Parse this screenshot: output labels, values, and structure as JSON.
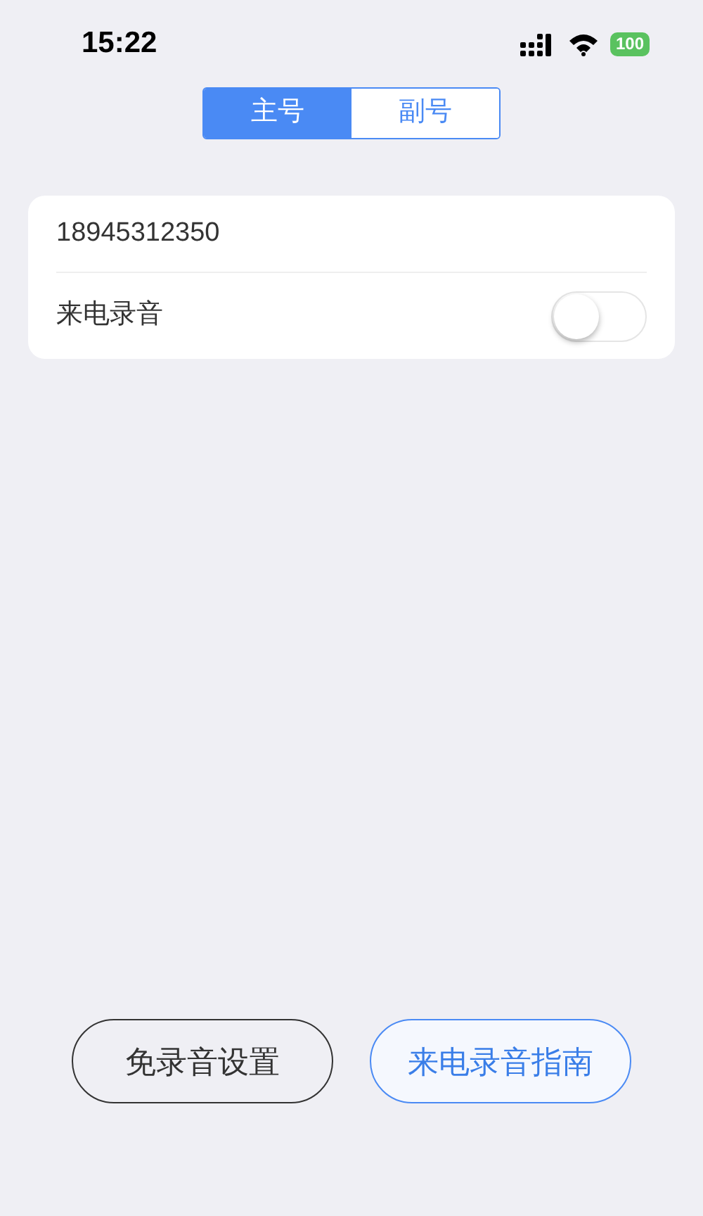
{
  "status_bar": {
    "time": "15:22",
    "battery": "100"
  },
  "tabs": [
    {
      "label": "主号",
      "selected": true
    },
    {
      "label": "副号",
      "selected": false
    }
  ],
  "card": {
    "number": "18945312350",
    "toggle": {
      "label": "来电录音",
      "on": false
    }
  },
  "buttons": [
    {
      "label": "免录音设置",
      "kind": "outline"
    },
    {
      "label": "来电录音指南",
      "kind": "primary"
    }
  ]
}
